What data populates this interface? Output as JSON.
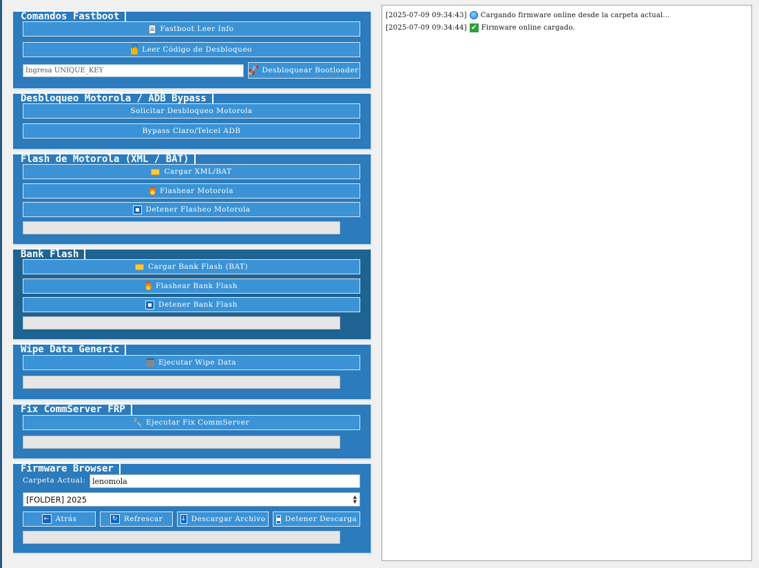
{
  "fastboot": {
    "title": "Comandos Fastboot",
    "info_label": "Fastboot Leer Info",
    "unlock_code_label": "Leer Código de Desbloqueo",
    "unique_key_placeholder": "Ingresa UNIQUE_KEY",
    "unlock_bootloader_label": "Desbloquear Bootloader"
  },
  "motorola_unlock": {
    "title": "Desbloqueo Motorola / ADB Bypass",
    "request_label": "Solicitar Desbloqueo Motorola",
    "bypass_label": "Bypass Claro/Telcel ADB"
  },
  "motorola_flash": {
    "title": "Flash de Motorola (XML / BAT)",
    "load_label": "Cargar XML/BAT",
    "flash_label": "Flashear Motorola",
    "stop_label": "Detener Flasheo Motorola",
    "progress": 0
  },
  "bank_flash": {
    "title": "Bank Flash",
    "load_label": "Cargar Bank Flash (BAT)",
    "flash_label": "Flashear Bank Flash",
    "stop_label": "Detener Bank Flash",
    "progress": 0
  },
  "wipe": {
    "title": "Wipe Data Generic",
    "run_label": "Ejecutar Wipe Data",
    "progress": 0
  },
  "fix_commserver": {
    "title": "Fix CommServer FRP",
    "run_label": "Ejecutar Fix CommServer",
    "progress": 0
  },
  "firmware_browser": {
    "title": "Firmware Browser",
    "current_folder_label": "Carpeta Actual:",
    "current_folder_value": "lenomola",
    "selected_item": "[FOLDER] 2025",
    "back_label": "Atrás",
    "refresh_label": "Refrescar",
    "download_label": "Descargar Archivo",
    "stop_download_label": "Detener Descarga",
    "progress": 0
  },
  "log": {
    "lines": [
      {
        "timestamp": "[2025-07-09 09:34:43]",
        "icon": "globe-icon",
        "text": "Cargando firmware online desde la carpeta actual..."
      },
      {
        "timestamp": "[2025-07-09 09:34:44]",
        "icon": "check-icon",
        "text": "Firmware online cargado."
      }
    ]
  },
  "colors": {
    "panel": "#2b7bbd",
    "panel_dark": "#1f6392",
    "button": "#3b93d6"
  }
}
